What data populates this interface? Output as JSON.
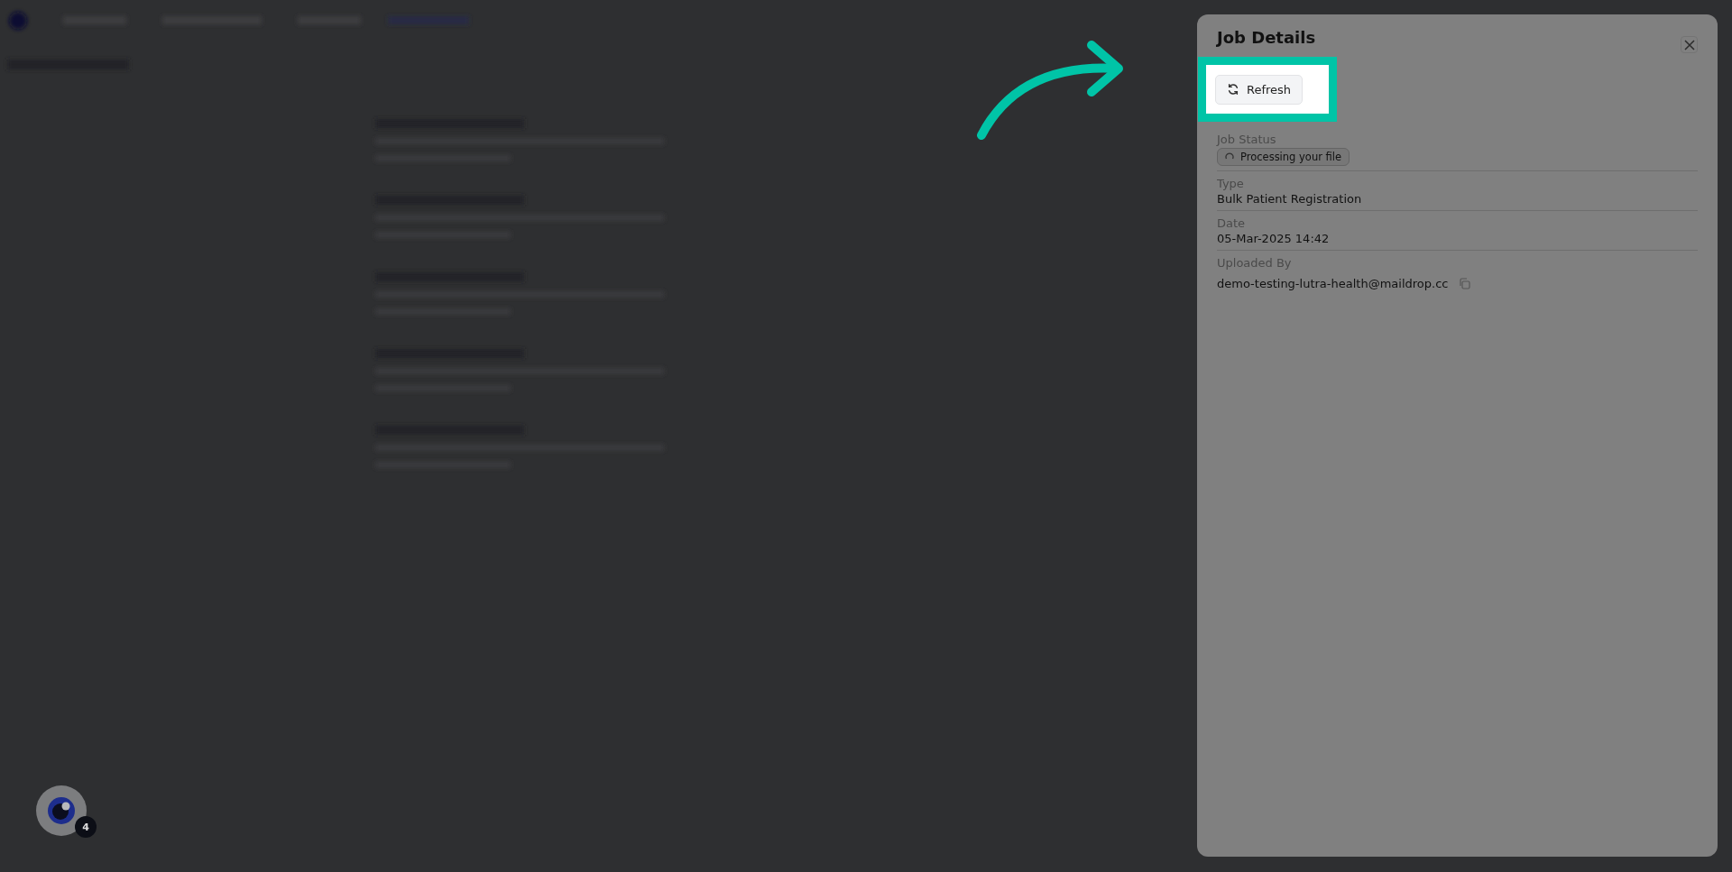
{
  "panel": {
    "title": "Job Details",
    "refresh_button": "Refresh",
    "fields": [
      {
        "kind": "badge",
        "label": "Job Status",
        "value": "Processing your file"
      },
      {
        "kind": "text",
        "label": "Type",
        "value": "Bulk Patient Registration"
      },
      {
        "kind": "text",
        "label": "Date",
        "value": "05-Mar-2025 14:42"
      },
      {
        "kind": "copy",
        "label": "Uploaded By",
        "value": "demo-testing-lutra-health@maildrop.cc"
      }
    ]
  },
  "help_badge": {
    "count": "4"
  }
}
